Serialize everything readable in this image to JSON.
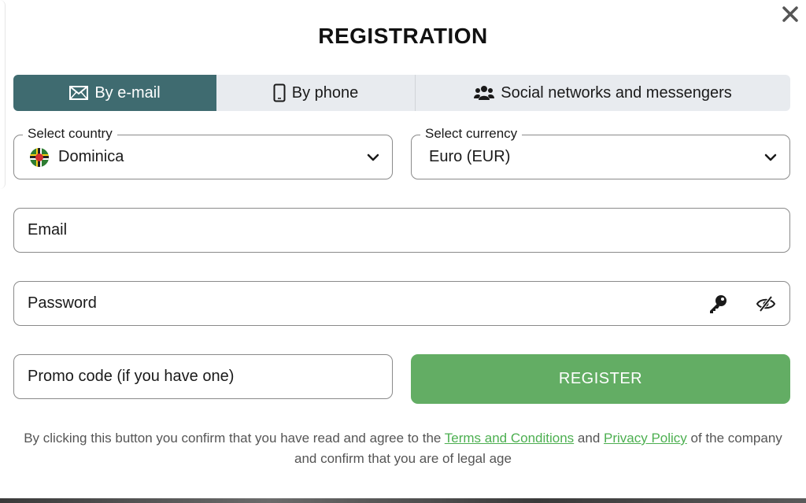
{
  "title": "REGISTRATION",
  "tabs": {
    "email": "By e-mail",
    "phone": "By phone",
    "social": "Social networks and messengers"
  },
  "country": {
    "legend": "Select country",
    "value": "Dominica"
  },
  "currency": {
    "legend": "Select currency",
    "value": "Euro (EUR)"
  },
  "email": {
    "placeholder": "Email"
  },
  "password": {
    "placeholder": "Password"
  },
  "promo": {
    "placeholder": "Promo code (if you have one)"
  },
  "register_label": "REGISTER",
  "terms": {
    "prefix": "By clicking this button you confirm that you have read and agree to the ",
    "terms_link": "Terms and Conditions",
    "and": " and ",
    "privacy_link": "Privacy Policy",
    "suffix": " of the company",
    "line2": "and confirm that you are of legal age"
  },
  "colors": {
    "active_tab": "#3f6b70",
    "register_button": "#63ad64",
    "link": "#4caf50"
  }
}
